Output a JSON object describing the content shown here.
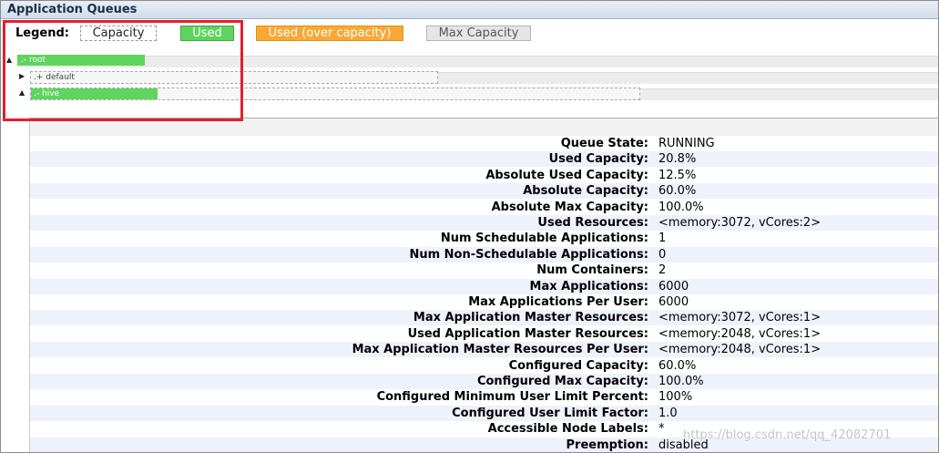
{
  "title": "Application Queues",
  "legend": {
    "label": "Legend:",
    "capacity": "Capacity",
    "used": "Used",
    "over": "Used (over capacity)",
    "max": "Max Capacity"
  },
  "colors": {
    "used": "#5dd55d",
    "over": "#f9a836",
    "max": "#e6e6e6",
    "highlight": "#e2202c"
  },
  "queues": [
    {
      "name": "root",
      "toggle": "▲",
      "used_fraction": 1.0
    },
    {
      "name": "default",
      "toggle": "▶",
      "used_fraction": 0.0
    },
    {
      "name": "hive",
      "toggle": "▲",
      "used_fraction": 0.208
    }
  ],
  "details": [
    {
      "key": "Queue State:",
      "value": "RUNNING"
    },
    {
      "key": "Used Capacity:",
      "value": "20.8%"
    },
    {
      "key": "Absolute Used Capacity:",
      "value": "12.5%"
    },
    {
      "key": "Absolute Capacity:",
      "value": "60.0%"
    },
    {
      "key": "Absolute Max Capacity:",
      "value": "100.0%"
    },
    {
      "key": "Used Resources:",
      "value": "<memory:3072, vCores:2>"
    },
    {
      "key": "Num Schedulable Applications:",
      "value": "1"
    },
    {
      "key": "Num Non-Schedulable Applications:",
      "value": "0"
    },
    {
      "key": "Num Containers:",
      "value": "2"
    },
    {
      "key": "Max Applications:",
      "value": "6000"
    },
    {
      "key": "Max Applications Per User:",
      "value": "6000"
    },
    {
      "key": "Max Application Master Resources:",
      "value": "<memory:3072, vCores:1>"
    },
    {
      "key": "Used Application Master Resources:",
      "value": "<memory:2048, vCores:1>"
    },
    {
      "key": "Max Application Master Resources Per User:",
      "value": "<memory:2048, vCores:1>"
    },
    {
      "key": "Configured Capacity:",
      "value": "60.0%"
    },
    {
      "key": "Configured Max Capacity:",
      "value": "100.0%"
    },
    {
      "key": "Configured Minimum User Limit Percent:",
      "value": "100%"
    },
    {
      "key": "Configured User Limit Factor:",
      "value": "1.0"
    },
    {
      "key": "Accessible Node Labels:",
      "value": "*"
    },
    {
      "key": "Preemption:",
      "value": "disabled"
    }
  ],
  "watermark": "https://blog.csdn.net/qq_42082701"
}
